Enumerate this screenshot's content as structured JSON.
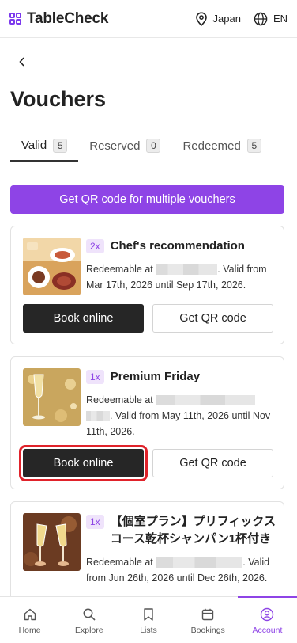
{
  "header": {
    "brand": "TableCheck",
    "region": "Japan",
    "language": "EN"
  },
  "page": {
    "title": "Vouchers"
  },
  "tabs": [
    {
      "label": "Valid",
      "count": "5",
      "active": true
    },
    {
      "label": "Reserved",
      "count": "0",
      "active": false
    },
    {
      "label": "Redeemed",
      "count": "5",
      "active": false
    }
  ],
  "qr_multiple_button": "Get QR code for multiple vouchers",
  "vouchers": [
    {
      "multiplier": "2x",
      "title": "Chef's recommendation",
      "redeemable_prefix": "Redeemable at",
      "validity": ". Valid from Mar 17th, 2026 until Sep 17th, 2026.",
      "book_label": "Book online",
      "qr_label": "Get QR code"
    },
    {
      "multiplier": "1x",
      "title": "Premium Friday",
      "redeemable_prefix": "Redeemable at",
      "validity": ". Valid from May 11th, 2026 until Nov 11th, 2026.",
      "book_label": "Book online",
      "qr_label": "Get QR code"
    },
    {
      "multiplier": "1x",
      "title": "【個室プラン】プリフィックスコース乾杯シャンパン1杯付き",
      "redeemable_prefix": "Redeemable at",
      "validity": ". Valid from Jun 26th, 2026 until Dec 26th, 2026."
    }
  ],
  "bottom_nav": [
    {
      "label": "Home",
      "icon": "home-icon"
    },
    {
      "label": "Explore",
      "icon": "search-icon"
    },
    {
      "label": "Lists",
      "icon": "bookmark-icon"
    },
    {
      "label": "Bookings",
      "icon": "calendar-icon"
    },
    {
      "label": "Account",
      "icon": "user-icon",
      "active": true
    }
  ],
  "colors": {
    "accent": "#8e44e6",
    "dark_button": "#262626",
    "highlight": "#e0222a"
  }
}
